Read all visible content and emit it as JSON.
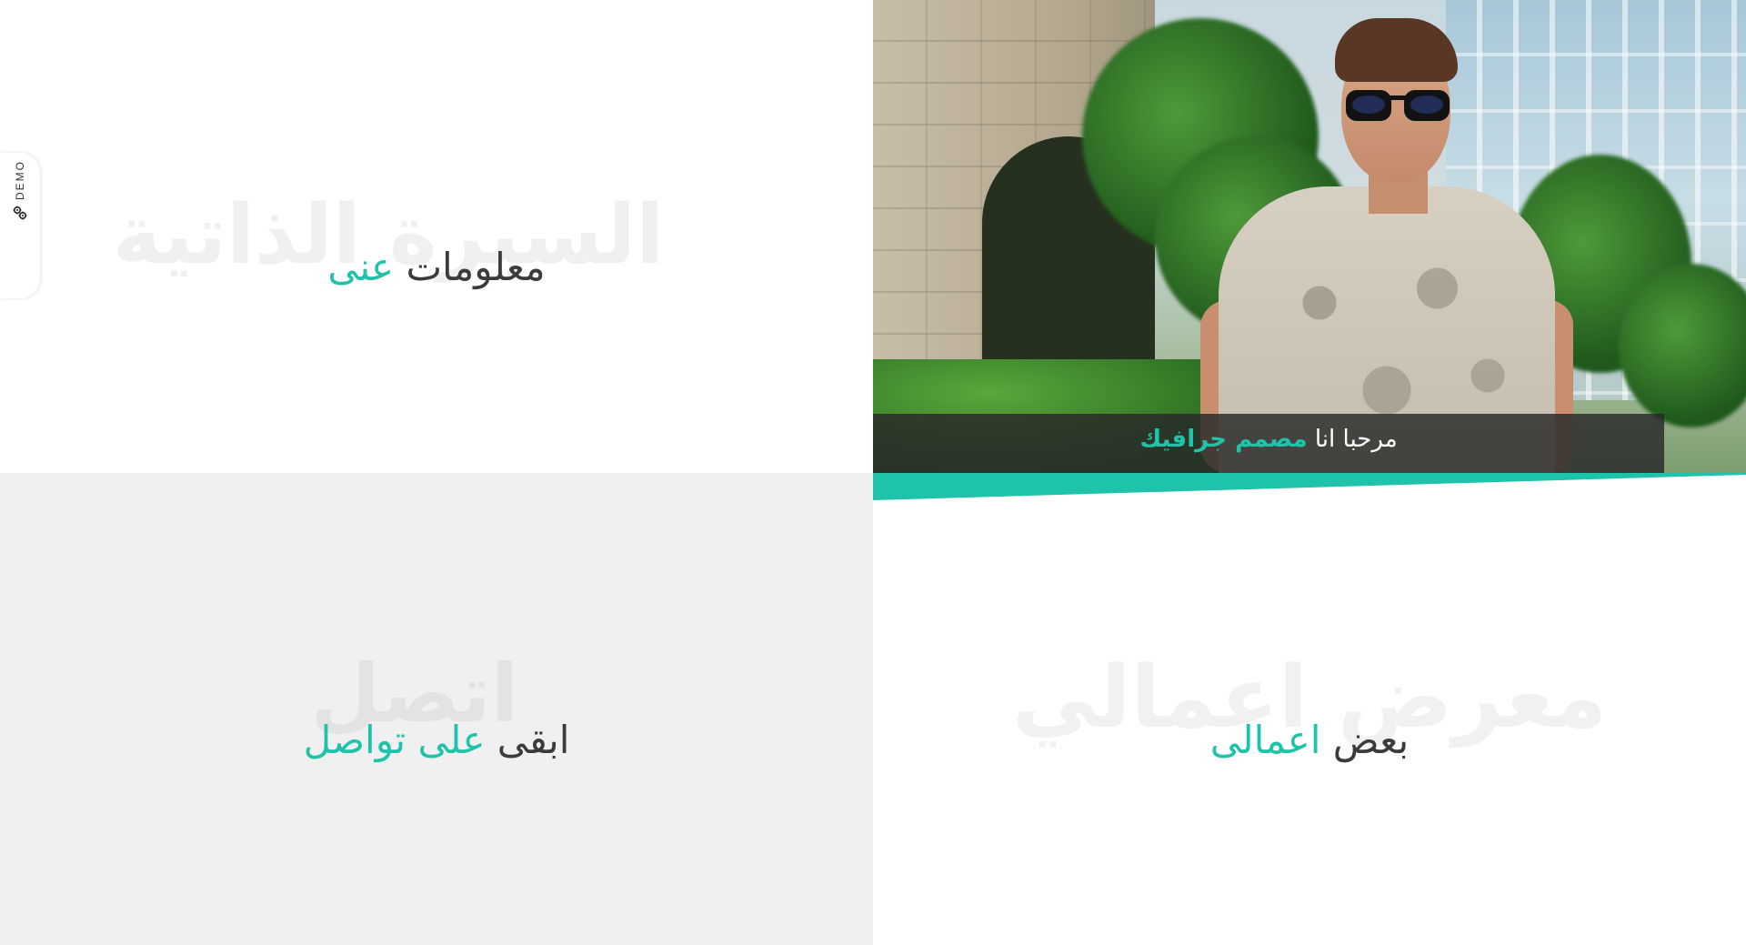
{
  "about": {
    "ghost": "السيرة الذاتية",
    "title_main": "معلومات",
    "title_accent": "عنى"
  },
  "hero": {
    "caption_main": "مرحبا انا",
    "caption_accent": "مصمم جرافيك"
  },
  "contact": {
    "ghost": "اتصل",
    "title_main": "ابقى",
    "title_accent_1": "على",
    "title_accent_2": "تواصل"
  },
  "portfolio": {
    "ghost": "معرض اعمالي",
    "title_main": "بعض",
    "title_accent": "اعمالى"
  },
  "demo": {
    "label": "DEMO",
    "icon": "gear-icon"
  },
  "colors": {
    "accent": "#1ec3a9",
    "heading": "#3b3b3b",
    "panel_gray": "#f0f0f0",
    "caption_bar": "#282828"
  }
}
